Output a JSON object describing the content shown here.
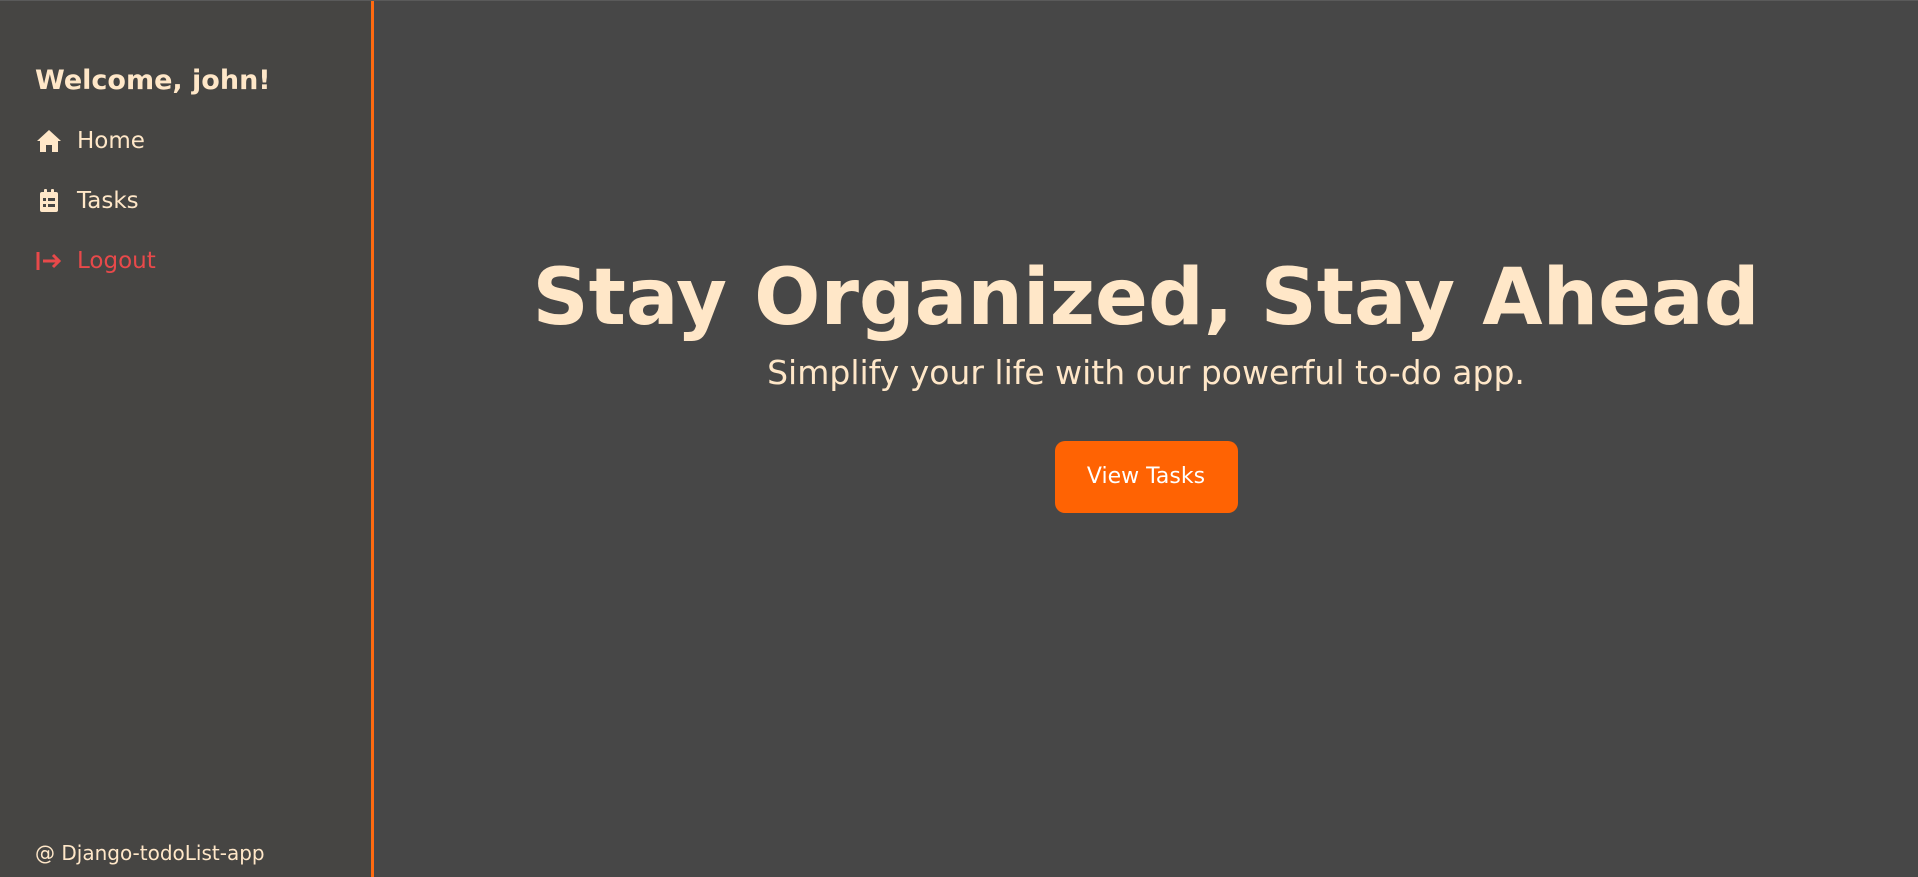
{
  "sidebar": {
    "welcome": "Welcome, john!",
    "items": [
      {
        "label": "Home",
        "icon": "home-icon"
      },
      {
        "label": "Tasks",
        "icon": "tasks-icon"
      },
      {
        "label": "Logout",
        "icon": "logout-icon"
      }
    ],
    "footer": "@ Django-todoList-app"
  },
  "hero": {
    "title": "Stay Organized, Stay Ahead",
    "subtitle": "Simplify your life with our powerful to-do app.",
    "button_label": "View Tasks"
  },
  "colors": {
    "accent": "#ff6303",
    "text": "#ffe7c8",
    "logout": "#e8494a",
    "sidebar_bg": "#464543",
    "main_bg": "#474747"
  }
}
